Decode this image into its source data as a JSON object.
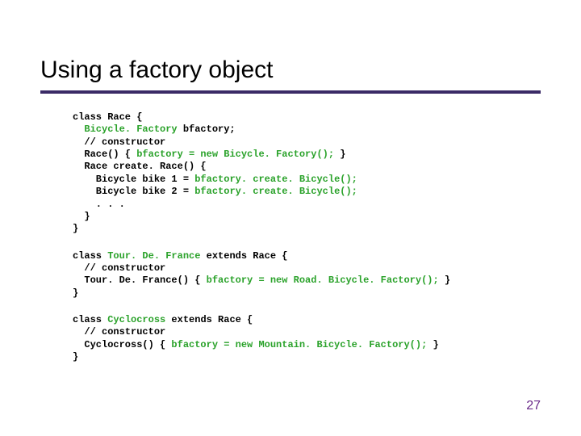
{
  "title": "Using a factory object",
  "page_number": "27",
  "code": {
    "race": [
      {
        "t": "class Race {"
      },
      {
        "i": 1,
        "frags": [
          [
            "  ",
            false
          ],
          [
            "Bicycle. Factory",
            true
          ],
          [
            " bfactory;",
            false
          ]
        ]
      },
      {
        "i": 1,
        "t": "  // constructor"
      },
      {
        "i": 1,
        "frags": [
          [
            "  Race() { ",
            false
          ],
          [
            "bfactory = new Bicycle. Factory();",
            true
          ],
          [
            " }",
            false
          ]
        ]
      },
      {
        "i": 1,
        "t": "  Race create. Race() {"
      },
      {
        "i": 2,
        "frags": [
          [
            "    Bicycle bike 1 = ",
            false
          ],
          [
            "bfactory. create. Bicycle();",
            true
          ]
        ]
      },
      {
        "i": 2,
        "frags": [
          [
            "    Bicycle bike 2 = ",
            false
          ],
          [
            "bfactory. create. Bicycle();",
            true
          ]
        ]
      },
      {
        "i": 2,
        "t": "    . . ."
      },
      {
        "i": 1,
        "t": "  }"
      },
      {
        "t": "}"
      }
    ],
    "tdf": [
      {
        "frags": [
          [
            "class ",
            false
          ],
          [
            "Tour. De. France",
            true
          ],
          [
            " extends Race {",
            false
          ]
        ]
      },
      {
        "i": 1,
        "t": "  // constructor"
      },
      {
        "i": 1,
        "frags": [
          [
            "  Tour. De. France() { ",
            false
          ],
          [
            "bfactory = new Road. Bicycle. Factory();",
            true
          ],
          [
            " }",
            false
          ]
        ]
      },
      {
        "t": "}"
      }
    ],
    "cyclo": [
      {
        "frags": [
          [
            "class ",
            false
          ],
          [
            "Cyclocross",
            true
          ],
          [
            " extends Race {",
            false
          ]
        ]
      },
      {
        "i": 1,
        "t": "  // constructor"
      },
      {
        "i": 1,
        "frags": [
          [
            "  Cyclocross() { ",
            false
          ],
          [
            "bfactory = new Mountain. Bicycle. Factory();",
            true
          ],
          [
            " }",
            false
          ]
        ]
      },
      {
        "t": "}"
      }
    ]
  }
}
